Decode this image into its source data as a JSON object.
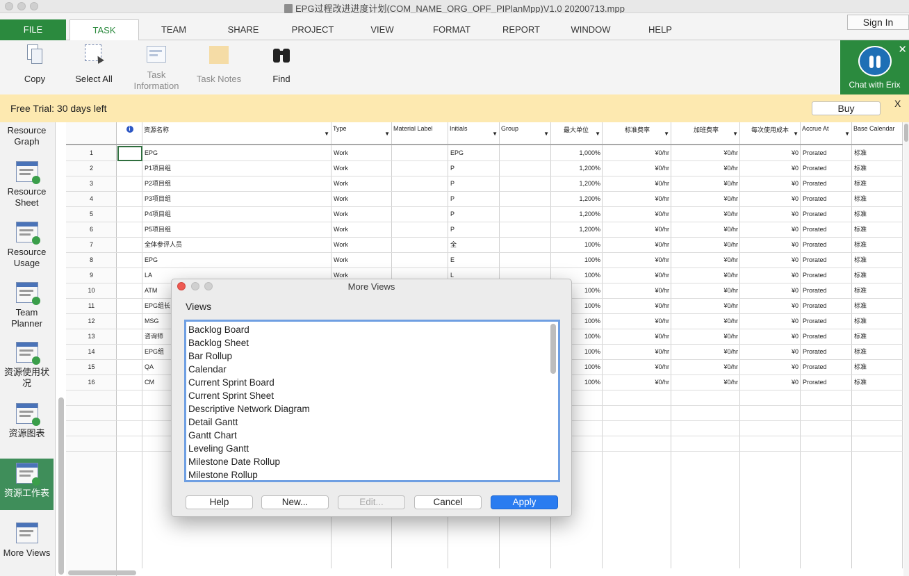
{
  "window": {
    "title": "EPG过程改进进度计划(COM_NAME_ORG_OPF_PIPlanMpp)V1.0 20200713.mpp",
    "sign_in": "Sign In"
  },
  "ribbon_tabs": [
    "FILE",
    "TASK",
    "TEAM",
    "SHARE",
    "PROJECT",
    "VIEW",
    "FORMAT",
    "REPORT",
    "WINDOW",
    "HELP"
  ],
  "ribbon_buttons": {
    "copy": "Copy",
    "select_all": "Select All",
    "task_information_1": "Task",
    "task_information_2": "Information",
    "task_notes": "Task Notes",
    "find": "Find"
  },
  "chat": {
    "label": "Chat with Erix",
    "close": "✕"
  },
  "trial_bar": {
    "text": "Free Trial: 30 days left",
    "buy": "Buy",
    "close": "X"
  },
  "view_bar": {
    "resource_graph_1": "Resource",
    "resource_graph_2": "Graph",
    "resource_sheet_1": "Resource",
    "resource_sheet_2": "Sheet",
    "resource_usage_1": "Resource",
    "resource_usage_2": "Usage",
    "team_planner": "Team Planner",
    "cn_usage": "资源使用状况",
    "cn_graph": "资源图表",
    "cn_sheet": "资源工作表",
    "more_views": "More Views"
  },
  "grid": {
    "headers": {
      "info": "i",
      "name": "资源名称",
      "type": "Type",
      "material": "Material Label",
      "initials": "Initials",
      "group": "Group",
      "max_units": "最大单位",
      "std_rate": "标准费率",
      "ovt_rate": "加班费率",
      "cost_use": "每次使用成本",
      "accrue": "Accrue At",
      "calendar": "Base Calendar"
    },
    "rows": [
      {
        "id": "1",
        "name": "EPG",
        "type": "Work",
        "initials": "EPG",
        "max": "1,000%",
        "std": "¥0/hr",
        "ovt": "¥0/hr",
        "cost": "¥0",
        "accrue": "Prorated",
        "cal": "标准"
      },
      {
        "id": "2",
        "name": "P1项目组",
        "type": "Work",
        "initials": "P",
        "max": "1,200%",
        "std": "¥0/hr",
        "ovt": "¥0/hr",
        "cost": "¥0",
        "accrue": "Prorated",
        "cal": "标准"
      },
      {
        "id": "3",
        "name": "P2项目组",
        "type": "Work",
        "initials": "P",
        "max": "1,200%",
        "std": "¥0/hr",
        "ovt": "¥0/hr",
        "cost": "¥0",
        "accrue": "Prorated",
        "cal": "标准"
      },
      {
        "id": "4",
        "name": "P3项目组",
        "type": "Work",
        "initials": "P",
        "max": "1,200%",
        "std": "¥0/hr",
        "ovt": "¥0/hr",
        "cost": "¥0",
        "accrue": "Prorated",
        "cal": "标准"
      },
      {
        "id": "5",
        "name": "P4项目组",
        "type": "Work",
        "initials": "P",
        "max": "1,200%",
        "std": "¥0/hr",
        "ovt": "¥0/hr",
        "cost": "¥0",
        "accrue": "Prorated",
        "cal": "标准"
      },
      {
        "id": "6",
        "name": "P5项目组",
        "type": "Work",
        "initials": "P",
        "max": "1,200%",
        "std": "¥0/hr",
        "ovt": "¥0/hr",
        "cost": "¥0",
        "accrue": "Prorated",
        "cal": "标准"
      },
      {
        "id": "7",
        "name": "全体参评人员",
        "type": "Work",
        "initials": "全",
        "max": "100%",
        "std": "¥0/hr",
        "ovt": "¥0/hr",
        "cost": "¥0",
        "accrue": "Prorated",
        "cal": "标准"
      },
      {
        "id": "8",
        "name": "EPG",
        "type": "Work",
        "initials": "E",
        "max": "100%",
        "std": "¥0/hr",
        "ovt": "¥0/hr",
        "cost": "¥0",
        "accrue": "Prorated",
        "cal": "标准"
      },
      {
        "id": "9",
        "name": "LA",
        "type": "Work",
        "initials": "L",
        "max": "100%",
        "std": "¥0/hr",
        "ovt": "¥0/hr",
        "cost": "¥0",
        "accrue": "Prorated",
        "cal": "标准"
      },
      {
        "id": "10",
        "name": "ATM",
        "type": "",
        "initials": "",
        "max": "100%",
        "std": "¥0/hr",
        "ovt": "¥0/hr",
        "cost": "¥0",
        "accrue": "Prorated",
        "cal": "标准"
      },
      {
        "id": "11",
        "name": "EPG组长",
        "type": "",
        "initials": "",
        "max": "100%",
        "std": "¥0/hr",
        "ovt": "¥0/hr",
        "cost": "¥0",
        "accrue": "Prorated",
        "cal": "标准"
      },
      {
        "id": "12",
        "name": "MSG",
        "type": "",
        "initials": "",
        "max": "100%",
        "std": "¥0/hr",
        "ovt": "¥0/hr",
        "cost": "¥0",
        "accrue": "Prorated",
        "cal": "标准"
      },
      {
        "id": "13",
        "name": "咨询师",
        "type": "",
        "initials": "",
        "max": "100%",
        "std": "¥0/hr",
        "ovt": "¥0/hr",
        "cost": "¥0",
        "accrue": "Prorated",
        "cal": "标准"
      },
      {
        "id": "14",
        "name": "EPG组",
        "type": "",
        "initials": "",
        "max": "100%",
        "std": "¥0/hr",
        "ovt": "¥0/hr",
        "cost": "¥0",
        "accrue": "Prorated",
        "cal": "标准"
      },
      {
        "id": "15",
        "name": "QA",
        "type": "",
        "initials": "",
        "max": "100%",
        "std": "¥0/hr",
        "ovt": "¥0/hr",
        "cost": "¥0",
        "accrue": "Prorated",
        "cal": "标准"
      },
      {
        "id": "16",
        "name": "CM",
        "type": "",
        "initials": "",
        "max": "100%",
        "std": "¥0/hr",
        "ovt": "¥0/hr",
        "cost": "¥0",
        "accrue": "Prorated",
        "cal": "标准"
      }
    ]
  },
  "dialog": {
    "title": "More Views",
    "label": "Views",
    "views": [
      "Backlog Board",
      "Backlog Sheet",
      "Bar Rollup",
      "Calendar",
      "Current Sprint Board",
      "Current Sprint Sheet",
      "Descriptive Network Diagram",
      "Detail Gantt",
      "Gantt Chart",
      "Leveling Gantt",
      "Milestone Date Rollup",
      "Milestone Rollup"
    ],
    "buttons": {
      "help": "Help",
      "new": "New...",
      "edit": "Edit...",
      "cancel": "Cancel",
      "apply": "Apply"
    }
  },
  "colors": {
    "accent_green": "#2b8a3e",
    "trial_bg": "#fde9b0",
    "apply_blue": "#2a7cf0"
  }
}
